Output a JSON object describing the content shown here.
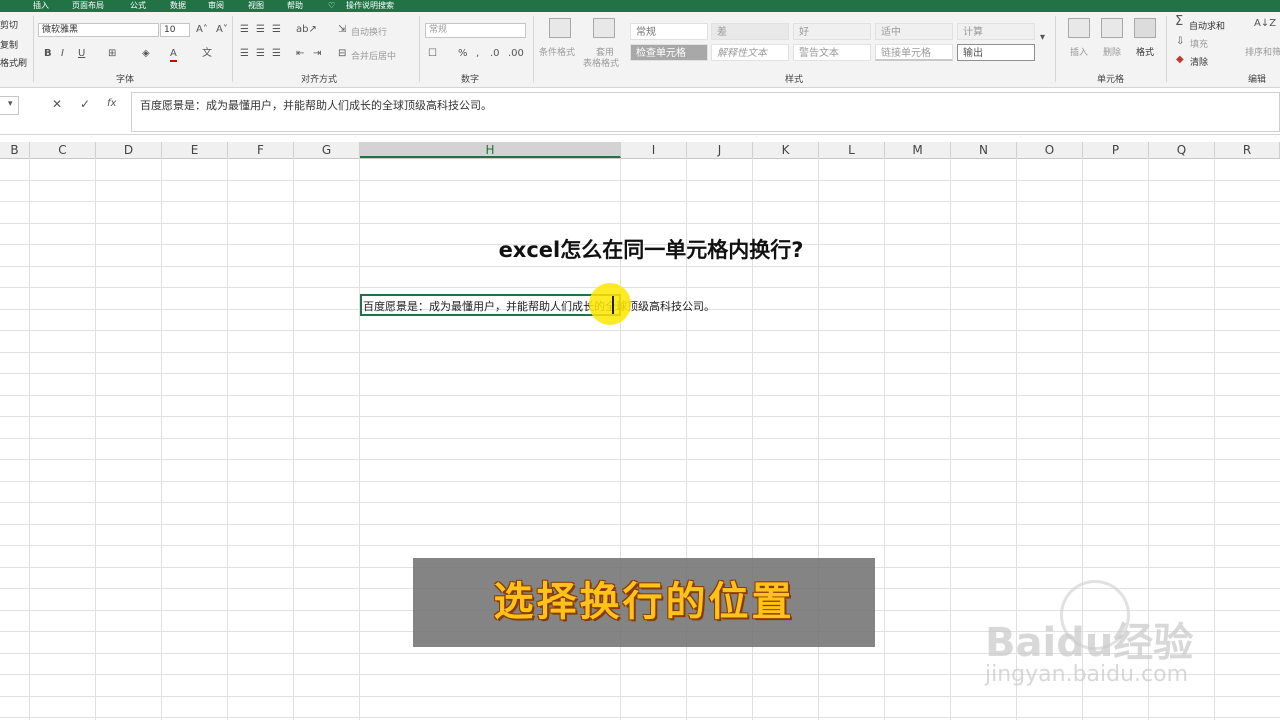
{
  "tabs": [
    "插入",
    "页面布局",
    "公式",
    "数据",
    "审阅",
    "视图",
    "帮助",
    "操作说明搜索"
  ],
  "clipboard": {
    "cut": "剪切",
    "copy": "复制",
    "format_painter": "格式刷"
  },
  "font": {
    "name": "微软雅黑",
    "size": "10",
    "group_label": "字体"
  },
  "alignment": {
    "wrap_text": "自动换行",
    "merge_center": "合并后居中",
    "group_label": "对齐方式"
  },
  "number": {
    "format": "常规",
    "group_label": "数字"
  },
  "styles": {
    "conditional_format": "条件格式",
    "table_format_l1": "套用",
    "table_format_l2": "表格格式",
    "cells": [
      "常规",
      "差",
      "好",
      "适中",
      "计算",
      "检查单元格",
      "解释性文本",
      "警告文本",
      "链接单元格",
      "输出"
    ],
    "group_label": "样式"
  },
  "cells_group": {
    "insert": "插入",
    "delete": "删除",
    "format": "格式",
    "group_label": "单元格"
  },
  "editing": {
    "autosum": "自动求和",
    "fill": "填充",
    "clear": "清除",
    "sort": "排序和筛选",
    "group_label": "编辑"
  },
  "formula_bar": {
    "fx": "fx",
    "content": "百度愿景是：成为最懂用户，并能帮助人们成长的全球顶级高科技公司。"
  },
  "columns": [
    "B",
    "C",
    "D",
    "E",
    "F",
    "G",
    "H",
    "I",
    "J",
    "K",
    "L",
    "M",
    "N",
    "O",
    "P",
    "Q",
    "R"
  ],
  "selected_column": "H",
  "sheet": {
    "title": "excel怎么在同一单元格内换行?",
    "cell_text": "百度愿景是：成为最懂用户，并能帮助人们成长的全球顶级高科技公司。"
  },
  "caption": "选择换行的位置",
  "watermark": {
    "logo": "Baidu经验",
    "url": "jingyan.baidu.com"
  },
  "colors": {
    "excel_green": "#217346",
    "caption_text": "#ffc21a",
    "cursor_highlight": "#ffe600"
  }
}
